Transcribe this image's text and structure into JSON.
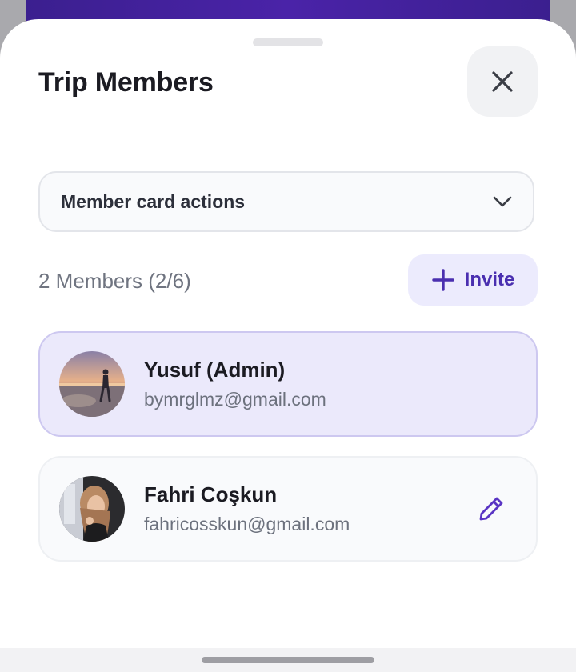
{
  "sheet": {
    "title": "Trip Members",
    "close_icon": "close-icon"
  },
  "actions_dropdown": {
    "label": "Member card actions",
    "icon": "chevron-down-icon"
  },
  "members_header": {
    "count_text": "2 Members (2/6)",
    "invite_label": "Invite",
    "invite_icon": "plus-icon"
  },
  "members": [
    {
      "name": "Yusuf (Admin)",
      "email": "bymrglmz@gmail.com",
      "role": "admin",
      "editable": false
    },
    {
      "name": "Fahri Coşkun",
      "email": "fahricosskun@gmail.com",
      "role": "member",
      "editable": true,
      "edit_icon": "pencil-icon"
    }
  ],
  "colors": {
    "accent": "#4a2fb0",
    "admin_card_bg": "#ebe9fb",
    "header_strip": "#3b1f8f"
  }
}
